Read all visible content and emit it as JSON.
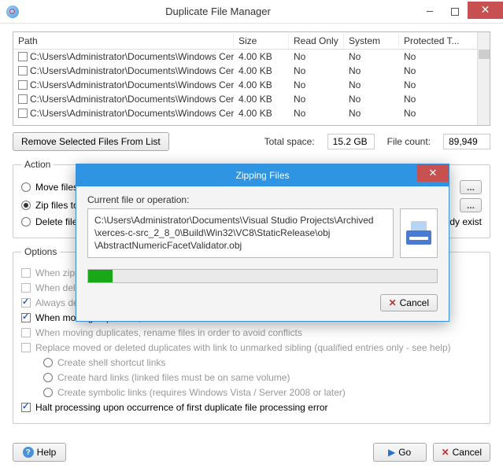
{
  "window": {
    "title": "Duplicate File Manager"
  },
  "table": {
    "headers": {
      "path": "Path",
      "size": "Size",
      "readonly": "Read Only",
      "system": "System",
      "protected": "Protected T..."
    },
    "rows": [
      {
        "path": "C:\\Users\\Administrator\\Documents\\Windows Certifi...",
        "size": "4.00 KB",
        "ro": "No",
        "sys": "No",
        "prot": "No"
      },
      {
        "path": "C:\\Users\\Administrator\\Documents\\Windows Certifi...",
        "size": "4.00 KB",
        "ro": "No",
        "sys": "No",
        "prot": "No"
      },
      {
        "path": "C:\\Users\\Administrator\\Documents\\Windows Certifi...",
        "size": "4.00 KB",
        "ro": "No",
        "sys": "No",
        "prot": "No"
      },
      {
        "path": "C:\\Users\\Administrator\\Documents\\Windows Certifi...",
        "size": "4.00 KB",
        "ro": "No",
        "sys": "No",
        "prot": "No"
      },
      {
        "path": "C:\\Users\\Administrator\\Documents\\Windows Certifi...",
        "size": "4.00 KB",
        "ro": "No",
        "sys": "No",
        "prot": "No"
      }
    ]
  },
  "toolbar": {
    "remove_button": "Remove Selected Files From List",
    "total_space_label": "Total space:",
    "total_space_value": "15.2 GB",
    "file_count_label": "File count:",
    "file_count_value": "89,949"
  },
  "action": {
    "legend": "Action",
    "move_label": "Move files",
    "zip_label": "Zip files to:",
    "delete_label": "Delete files",
    "already_exist_suffix": "dy exist",
    "browse": "..."
  },
  "options": {
    "legend": "Options",
    "when_zip": "When zippi",
    "when_del": "When dele",
    "always_del": "Always del",
    "retain_folder": "When moving duplicates, retain folder structure",
    "rename_avoid": "When moving duplicates, rename files in order to avoid conflicts",
    "replace_link": "Replace moved or deleted duplicates with link to unmarked sibling (qualified entries only - see help)",
    "shell_links": "Create shell shortcut links",
    "hard_links": "Create hard links (linked files must be on same volume)",
    "symbolic_links": "Create symbolic links (requires Windows Vista / Server 2008 or later)",
    "halt_error": "Halt processing upon occurrence of first duplicate file processing error"
  },
  "bottom": {
    "help": "Help",
    "go": "Go",
    "cancel": "Cancel"
  },
  "dialog": {
    "title": "Zipping Files",
    "current_label": "Current file or operation:",
    "line1": "C:\\Users\\Administrator\\Documents\\Visual Studio Projects\\Archived",
    "line2": "\\xerces-c-src_2_8_0\\Build\\Win32\\VC8\\StaticRelease\\obj",
    "line3": "\\AbstractNumericFacetValidator.obj",
    "cancel": "Cancel"
  }
}
